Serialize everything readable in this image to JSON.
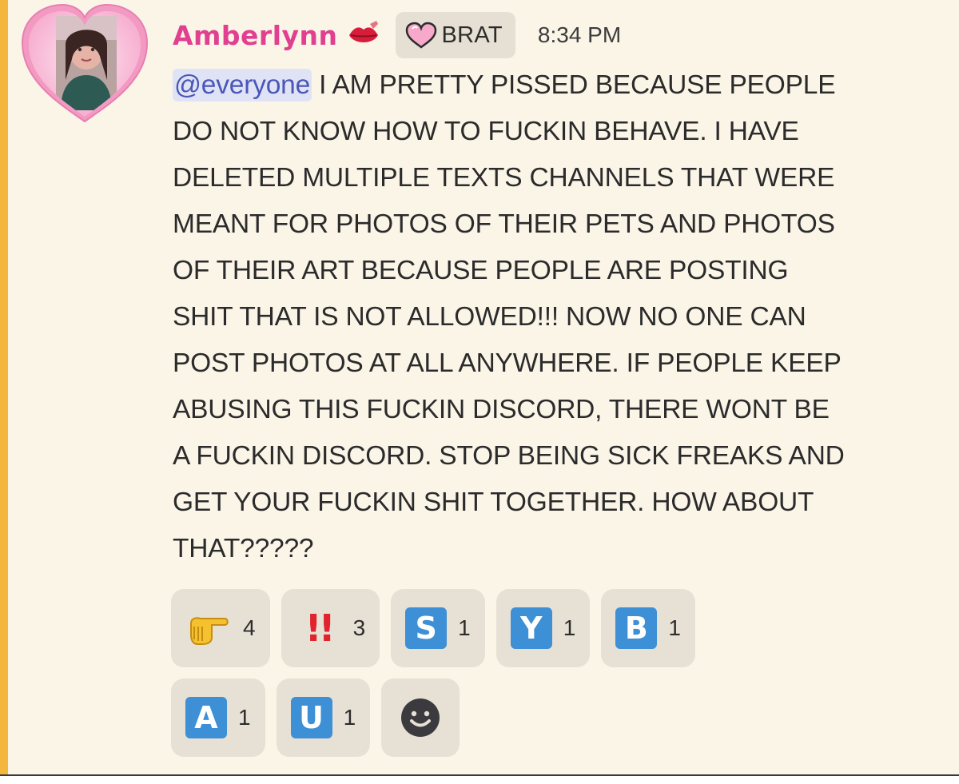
{
  "author": {
    "name": "Amberlynn",
    "tag": "BRAT",
    "timestamp": "8:34 PM"
  },
  "message": {
    "mention": "@everyone",
    "text": " I AM PRETTY PISSED BECAUSE PEOPLE\nDO NOT KNOW HOW TO FUCKIN BEHAVE. I HAVE\nDELETED MULTIPLE TEXTS CHANNELS THAT WERE\nMEANT FOR PHOTOS OF THEIR PETS AND PHOTOS\nOF THEIR ART BECAUSE PEOPLE ARE POSTING\nSHIT THAT IS NOT ALLOWED!!! NOW NO ONE CAN\nPOST PHOTOS AT ALL ANYWHERE. IF PEOPLE KEEP\nABUSING THIS FUCKIN DISCORD, THERE WONT BE\nA FUCKIN DISCORD. STOP BEING SICK FREAKS AND\nGET YOUR FUCKIN SHIT TOGETHER. HOW ABOUT\nTHAT?????"
  },
  "reactions": [
    {
      "icon": "pointing-hand-icon",
      "count": "4"
    },
    {
      "icon": "double-exclamation-icon",
      "glyph": "!!",
      "count": "3"
    },
    {
      "icon": "regional-letter-s-icon",
      "letter": "S",
      "count": "1"
    },
    {
      "icon": "regional-letter-y-icon",
      "letter": "Y",
      "count": "1"
    },
    {
      "icon": "regional-letter-b-icon",
      "letter": "B",
      "count": "1"
    },
    {
      "icon": "regional-letter-a-icon",
      "letter": "A",
      "count": "1"
    },
    {
      "icon": "regional-letter-u-icon",
      "letter": "U",
      "count": "1"
    }
  ],
  "colors": {
    "background": "#fbf5e8",
    "accent_bar": "#f4b63c",
    "username": "#e0408f",
    "mention_bg": "#dfe3f5",
    "mention_text": "#4a57b8",
    "letter_tile": "#3d8fd6",
    "exclamation": "#e0232e"
  }
}
